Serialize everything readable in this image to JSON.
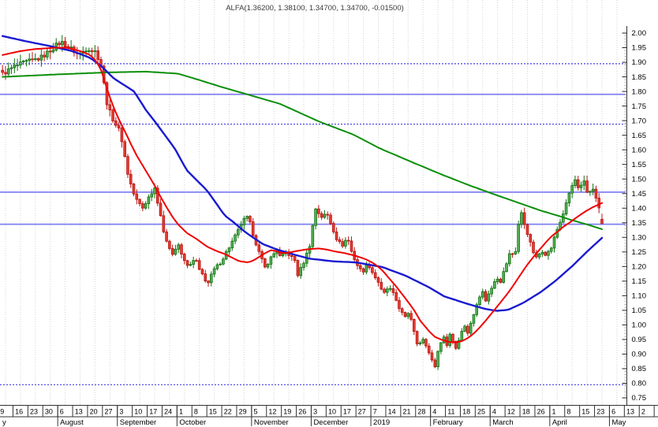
{
  "title": "ALFA(1.36200, 1.38100, 1.34700, 1.34700, -0.01500)",
  "chart_data": {
    "type": "candlestick",
    "symbol": "ALFA",
    "last_quote": {
      "open": 1.362,
      "high": 1.381,
      "low": 1.347,
      "close": 1.347,
      "change": -0.015
    },
    "y_axis": {
      "min": 0.75,
      "max": 2.0,
      "step": 0.05,
      "labels": [
        "2.00",
        "1.95",
        "1.90",
        "1.85",
        "1.80",
        "1.75",
        "1.70",
        "1.65",
        "1.60",
        "1.55",
        "1.50",
        "1.45",
        "1.40",
        "1.35",
        "1.30",
        "1.25",
        "1.20",
        "1.15",
        "1.10",
        "1.05",
        "1.00",
        "0.95",
        "0.90",
        "0.85",
        "0.80",
        "0.75"
      ]
    },
    "x_axis": {
      "week_labels": [
        "9",
        "16",
        "23",
        "30",
        "6",
        "13",
        "20",
        "27",
        "3",
        "10",
        "17",
        "24",
        "1",
        "8",
        "15",
        "22",
        "29",
        "5",
        "12",
        "19",
        "26",
        "3",
        "10",
        "17",
        "27",
        "7",
        "14",
        "21",
        "28",
        "4",
        "11",
        "18",
        "25",
        "4",
        "12",
        "18",
        "26",
        "1",
        "8",
        "15",
        "23",
        "6",
        "13",
        "2"
      ],
      "months": [
        {
          "label": "y",
          "weeks": 4
        },
        {
          "label": "August",
          "weeks": 4
        },
        {
          "label": "September",
          "weeks": 4
        },
        {
          "label": "October",
          "weeks": 5
        },
        {
          "label": "November",
          "weeks": 4
        },
        {
          "label": "December",
          "weeks": 4
        },
        {
          "label": "2019",
          "weeks": 4
        },
        {
          "label": "February",
          "weeks": 4
        },
        {
          "label": "March",
          "weeks": 4
        },
        {
          "label": "April",
          "weeks": 4
        },
        {
          "label": "May",
          "weeks": 3
        }
      ]
    },
    "horizontal_lines": {
      "solid": [
        1.79,
        1.455,
        1.345
      ],
      "dotted": [
        1.895,
        1.688,
        0.795
      ]
    },
    "series": {
      "price_anchors": [
        [
          0,
          1.86
        ],
        [
          4,
          1.885
        ],
        [
          8,
          1.9
        ],
        [
          13,
          1.915
        ],
        [
          15,
          1.93
        ],
        [
          18,
          1.955
        ],
        [
          20,
          1.97
        ],
        [
          23,
          1.95
        ],
        [
          26,
          1.925
        ],
        [
          29,
          1.95
        ],
        [
          32,
          1.935
        ],
        [
          34,
          1.88
        ],
        [
          35,
          1.8
        ],
        [
          36,
          1.745
        ],
        [
          38,
          1.7
        ],
        [
          40,
          1.665
        ],
        [
          41,
          1.625
        ],
        [
          42,
          1.565
        ],
        [
          43,
          1.51
        ],
        [
          45,
          1.445
        ],
        [
          46,
          1.425
        ],
        [
          48,
          1.4
        ],
        [
          49,
          1.42
        ],
        [
          51,
          1.455
        ],
        [
          52,
          1.47
        ],
        [
          54,
          1.38
        ],
        [
          55,
          1.315
        ],
        [
          57,
          1.27
        ],
        [
          58,
          1.24
        ],
        [
          60,
          1.275
        ],
        [
          62,
          1.22
        ],
        [
          64,
          1.2
        ],
        [
          66,
          1.23
        ],
        [
          67,
          1.19
        ],
        [
          69,
          1.165
        ],
        [
          70,
          1.135
        ],
        [
          72,
          1.185
        ],
        [
          75,
          1.22
        ],
        [
          76,
          1.24
        ],
        [
          78,
          1.275
        ],
        [
          81,
          1.33
        ],
        [
          82,
          1.355
        ],
        [
          84,
          1.37
        ],
        [
          86,
          1.3
        ],
        [
          88,
          1.24
        ],
        [
          90,
          1.19
        ],
        [
          91,
          1.22
        ],
        [
          94,
          1.26
        ],
        [
          95,
          1.23
        ],
        [
          97,
          1.25
        ],
        [
          100,
          1.22
        ],
        [
          101,
          1.17
        ],
        [
          103,
          1.215
        ],
        [
          105,
          1.27
        ],
        [
          107,
          1.4
        ],
        [
          109,
          1.37
        ],
        [
          111,
          1.38
        ],
        [
          113,
          1.33
        ],
        [
          114,
          1.3
        ],
        [
          116,
          1.27
        ],
        [
          118,
          1.3
        ],
        [
          119,
          1.26
        ],
        [
          121,
          1.21
        ],
        [
          123,
          1.18
        ],
        [
          125,
          1.21
        ],
        [
          127,
          1.17
        ],
        [
          129,
          1.14
        ],
        [
          130,
          1.1
        ],
        [
          132,
          1.13
        ],
        [
          134,
          1.1
        ],
        [
          136,
          1.05
        ],
        [
          138,
          1.02
        ],
        [
          139,
          1.05
        ],
        [
          141,
          0.97
        ],
        [
          142,
          0.93
        ],
        [
          144,
          0.95
        ],
        [
          146,
          0.9
        ],
        [
          147,
          0.88
        ],
        [
          148,
          0.85
        ],
        [
          149,
          0.92
        ],
        [
          151,
          0.96
        ],
        [
          152,
          0.93
        ],
        [
          153,
          0.97
        ],
        [
          155,
          0.92
        ],
        [
          156,
          0.95
        ],
        [
          158,
          1.0
        ],
        [
          159,
          0.97
        ],
        [
          161,
          1.03
        ],
        [
          162,
          1.07
        ],
        [
          164,
          1.12
        ],
        [
          165,
          1.08
        ],
        [
          167,
          1.12
        ],
        [
          169,
          1.17
        ],
        [
          170,
          1.14
        ],
        [
          172,
          1.2
        ],
        [
          174,
          1.26
        ],
        [
          175,
          1.22
        ],
        [
          176,
          1.3
        ],
        [
          177,
          1.4
        ],
        [
          178,
          1.36
        ],
        [
          180,
          1.3
        ],
        [
          181,
          1.26
        ],
        [
          183,
          1.22
        ],
        [
          184,
          1.26
        ],
        [
          186,
          1.24
        ],
        [
          188,
          1.27
        ],
        [
          189,
          1.31
        ],
        [
          191,
          1.36
        ],
        [
          193,
          1.42
        ],
        [
          194,
          1.46
        ],
        [
          196,
          1.5
        ],
        [
          197,
          1.46
        ],
        [
          199,
          1.49
        ],
        [
          200,
          1.45
        ],
        [
          202,
          1.47
        ],
        [
          203,
          1.43
        ],
        [
          204,
          1.4
        ],
        [
          205,
          1.347
        ]
      ],
      "ma_long_green": [
        [
          0,
          1.85
        ],
        [
          20,
          1.859
        ],
        [
          35,
          1.865
        ],
        [
          49,
          1.868
        ],
        [
          60,
          1.861
        ],
        [
          67,
          1.84
        ],
        [
          75,
          1.815
        ],
        [
          83,
          1.792
        ],
        [
          95,
          1.757
        ],
        [
          108,
          1.698
        ],
        [
          120,
          1.652
        ],
        [
          129,
          1.605
        ],
        [
          140,
          1.558
        ],
        [
          151,
          1.512
        ],
        [
          160,
          1.477
        ],
        [
          168,
          1.448
        ],
        [
          176,
          1.42
        ],
        [
          184,
          1.392
        ],
        [
          190,
          1.374
        ],
        [
          195,
          1.358
        ],
        [
          200,
          1.344
        ],
        [
          205,
          1.328
        ]
      ],
      "ma_medium_blue": [
        [
          0,
          1.99
        ],
        [
          8,
          1.972
        ],
        [
          16,
          1.956
        ],
        [
          24,
          1.938
        ],
        [
          30,
          1.915
        ],
        [
          34,
          1.885
        ],
        [
          38,
          1.845
        ],
        [
          45,
          1.8
        ],
        [
          49,
          1.737
        ],
        [
          53,
          1.685
        ],
        [
          59,
          1.603
        ],
        [
          63,
          1.53
        ],
        [
          70,
          1.46
        ],
        [
          76,
          1.375
        ],
        [
          79,
          1.352
        ],
        [
          83,
          1.318
        ],
        [
          89,
          1.277
        ],
        [
          94,
          1.258
        ],
        [
          100,
          1.24
        ],
        [
          105,
          1.227
        ],
        [
          113,
          1.218
        ],
        [
          121,
          1.214
        ],
        [
          130,
          1.198
        ],
        [
          138,
          1.168
        ],
        [
          146,
          1.128
        ],
        [
          151,
          1.098
        ],
        [
          159,
          1.072
        ],
        [
          165,
          1.055
        ],
        [
          169,
          1.048
        ],
        [
          173,
          1.052
        ],
        [
          178,
          1.075
        ],
        [
          184,
          1.112
        ],
        [
          189,
          1.15
        ],
        [
          195,
          1.203
        ],
        [
          200,
          1.252
        ],
        [
          205,
          1.298
        ]
      ],
      "ma_short_red": [
        [
          0,
          1.925
        ],
        [
          6,
          1.938
        ],
        [
          11,
          1.945
        ],
        [
          18,
          1.95
        ],
        [
          22,
          1.95
        ],
        [
          27,
          1.937
        ],
        [
          30,
          1.925
        ],
        [
          32,
          1.905
        ],
        [
          34,
          1.868
        ],
        [
          36,
          1.8
        ],
        [
          38,
          1.745
        ],
        [
          40,
          1.7
        ],
        [
          42,
          1.66
        ],
        [
          44,
          1.618
        ],
        [
          46,
          1.578
        ],
        [
          48,
          1.545
        ],
        [
          50,
          1.512
        ],
        [
          52,
          1.478
        ],
        [
          54,
          1.44
        ],
        [
          56,
          1.405
        ],
        [
          58,
          1.372
        ],
        [
          60,
          1.345
        ],
        [
          63,
          1.315
        ],
        [
          66,
          1.297
        ],
        [
          70,
          1.268
        ],
        [
          73,
          1.254
        ],
        [
          76,
          1.243
        ],
        [
          79,
          1.228
        ],
        [
          81,
          1.218
        ],
        [
          84,
          1.214
        ],
        [
          86,
          1.222
        ],
        [
          90,
          1.247
        ],
        [
          92,
          1.257
        ],
        [
          95,
          1.248
        ],
        [
          97,
          1.246
        ],
        [
          100,
          1.252
        ],
        [
          104,
          1.259
        ],
        [
          108,
          1.262
        ],
        [
          111,
          1.258
        ],
        [
          113,
          1.253
        ],
        [
          117,
          1.246
        ],
        [
          121,
          1.236
        ],
        [
          124,
          1.226
        ],
        [
          127,
          1.211
        ],
        [
          130,
          1.186
        ],
        [
          132,
          1.162
        ],
        [
          135,
          1.127
        ],
        [
          138,
          1.088
        ],
        [
          141,
          1.047
        ],
        [
          143,
          1.012
        ],
        [
          146,
          0.977
        ],
        [
          148,
          0.958
        ],
        [
          151,
          0.946
        ],
        [
          153,
          0.941
        ],
        [
          155,
          0.94
        ],
        [
          157,
          0.944
        ],
        [
          159,
          0.954
        ],
        [
          161,
          0.969
        ],
        [
          163,
          0.989
        ],
        [
          165,
          1.012
        ],
        [
          167,
          1.036
        ],
        [
          169,
          1.061
        ],
        [
          171,
          1.086
        ],
        [
          173,
          1.111
        ],
        [
          175,
          1.14
        ],
        [
          177,
          1.17
        ],
        [
          179,
          1.2
        ],
        [
          181,
          1.226
        ],
        [
          184,
          1.262
        ],
        [
          186,
          1.285
        ],
        [
          188,
          1.306
        ],
        [
          190,
          1.321
        ],
        [
          192,
          1.338
        ],
        [
          194,
          1.351
        ],
        [
          196,
          1.366
        ],
        [
          198,
          1.38
        ],
        [
          200,
          1.393
        ],
        [
          202,
          1.404
        ],
        [
          204,
          1.413
        ],
        [
          205,
          1.418
        ]
      ]
    },
    "colors": {
      "background": "#ffffff",
      "candle_up_fill": "#58b058",
      "candle_up_stroke": "#107010",
      "candle_down_fill": "#e43d33",
      "candle_down_stroke": "#b81410",
      "ma_short": "#f00000",
      "ma_medium": "#1a1ad0",
      "ma_long": "#0a8f0a",
      "level_solid": "#8080f0",
      "level_dotted": "#4040e8",
      "grid": "#d4d4d4",
      "axis": "#333333",
      "text": "#000000"
    }
  }
}
